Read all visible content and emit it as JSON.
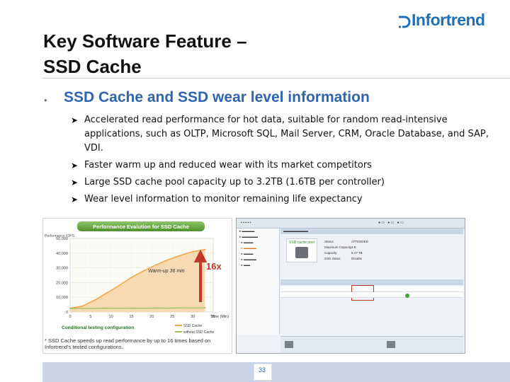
{
  "logo": {
    "text": "Infortrend",
    "brand_color": "#1f6fb5"
  },
  "slide": {
    "title_line1": "Key Software Feature –",
    "title_line2": "SSD Cache",
    "bullet": "SSD Cache and SSD wear level information",
    "sub_bullets": [
      "Accelerated read performance for hot data, suitable for random read-intensive applications, such as OLTP, Microsoft SQL, Mail Server, CRM, Oracle Database, and SAP, VDI.",
      "Faster warm up and reduced wear with its market competitors",
      "Large SSD cache pool capacity up to 3.2TB (1.6TB per controller)",
      "Wear level information to monitor remaining life expectancy"
    ],
    "page_number": "33"
  },
  "chart_data": {
    "type": "area",
    "title": "Performance Evalution for SSD Cache",
    "ylabel": "Performance IOPS",
    "xlabel": "Time (Min)",
    "x_ticks": [
      "0",
      "5",
      "10",
      "15",
      "20",
      "25",
      "30",
      "35"
    ],
    "y_ticks": [
      "0",
      "10,000",
      "20,000",
      "30,000",
      "40,000",
      "50,000"
    ],
    "xlim": [
      0,
      35
    ],
    "ylim": [
      0,
      50000
    ],
    "series": [
      {
        "name": "SSD Cache",
        "color": "#f2a74c",
        "x": [
          0,
          3,
          6,
          9,
          12,
          15,
          18,
          21,
          24,
          27,
          30,
          33
        ],
        "values": [
          2500,
          4000,
          8000,
          13000,
          18000,
          23500,
          28000,
          32000,
          35500,
          38500,
          41000,
          42500
        ]
      },
      {
        "name": "without SSD Cache",
        "color": "#9bbf5b",
        "x": [
          0,
          3,
          6,
          9,
          12,
          15,
          18,
          21,
          24,
          27,
          30,
          33
        ],
        "values": [
          2400,
          2500,
          2400,
          2600,
          2500,
          2600,
          2500,
          2700,
          2600,
          2800,
          2700,
          2800
        ]
      }
    ],
    "annotations": [
      "Warm-up 36 min",
      "16x"
    ],
    "subheading": "Conditional testing configuration",
    "footnote": "* SSD Cache speeds up read performance by up to 16 times based on Infortrend's tested configurations."
  },
  "screenshot": {
    "pool_label": "SSD cache pool",
    "fields": [
      "Status",
      "Maximum Capacity",
      "Capacity",
      "SSD status"
    ],
    "values": [
      "ATTENDED",
      "4.8",
      "8.47 TB",
      "Disable"
    ]
  }
}
